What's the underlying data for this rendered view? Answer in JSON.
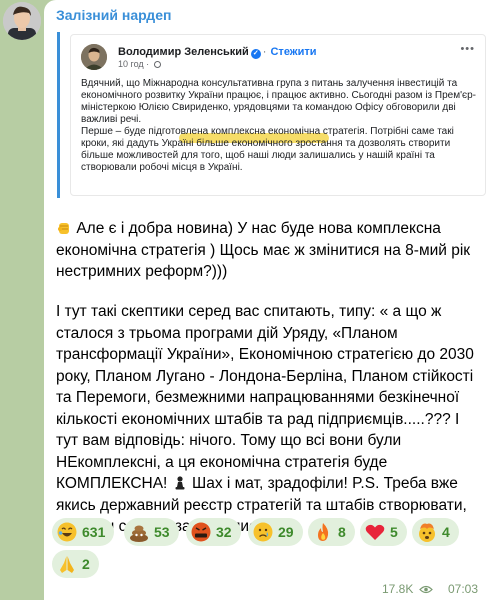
{
  "channel": {
    "name": "Залізний нардеп"
  },
  "embed": {
    "author": "Володимир Зеленський",
    "follow_label": "Стежити",
    "post_time": "10 год",
    "paragraph1": "Вдячний, що Міжнародна консультативна група з питань залучення інвестицій та економічного розвитку України працює, і працює активно. Сьогодні разом із Прем'єр-міністеркою Юлією Свириденко, урядовцями та командою Офісу обговорили дві важливі речі.",
    "paragraph2": "Перше – буде підготовлена комплексна економічна стратегія. Потрібні саме такі кроки, які дадуть Україні більше економічного зростання та дозволять створити більше можливостей для того, щоб наші люди залишались у нашій країні та створювали робочі місця в Україні."
  },
  "message": {
    "paragraph1": "Але є і добра новина) У нас буде нова комплексна економічна стратегія ) Щось має ж змінитися на 8-мий рік нестримних реформ?)))",
    "paragraph2_a": "І тут такі скептики серед вас спитають, типу: « а що ж сталося з трьома програми дій Уряду, «Планом трансформації України», Економічною стратегією до 2030 року, Планом Лугано - Лондона-Берліна, Планом стійкості та Перемоги, безмежними напрацюваннями безкінечної кількості економічних штабів та рад підприємців.....??? І тут вам відповідь: нічого. Тому що всі вони були НЕкомплексні, а ця економічна стратегія буде КОМПЛЕКСНА!",
    "paragraph2_b": "Шах і мат, зрадофіли! P.S. Треба вже якись державний реєстр стратегій та штабів створювати, щоб хоч самі не заплутались))))"
  },
  "reactions": [
    {
      "icon": "rofl-emoji-icon",
      "count": "631"
    },
    {
      "icon": "poop-emoji-icon",
      "count": "53"
    },
    {
      "icon": "angry-emoji-icon",
      "count": "32"
    },
    {
      "icon": "crying-emoji-icon",
      "count": "29"
    },
    {
      "icon": "fire-emoji-icon",
      "count": "8"
    },
    {
      "icon": "heart-emoji-icon",
      "count": "5"
    },
    {
      "icon": "exploding-head-emoji-icon",
      "count": "4"
    },
    {
      "icon": "praying-hands-emoji-icon",
      "count": "2"
    }
  ],
  "footer": {
    "views": "17.8K",
    "time": "07:03"
  },
  "colors": {
    "chat_background": "#b7cda3",
    "accent": "#3a8fd8",
    "reaction_bg": "#e2f0dd",
    "reaction_text": "#3e8a2c"
  }
}
